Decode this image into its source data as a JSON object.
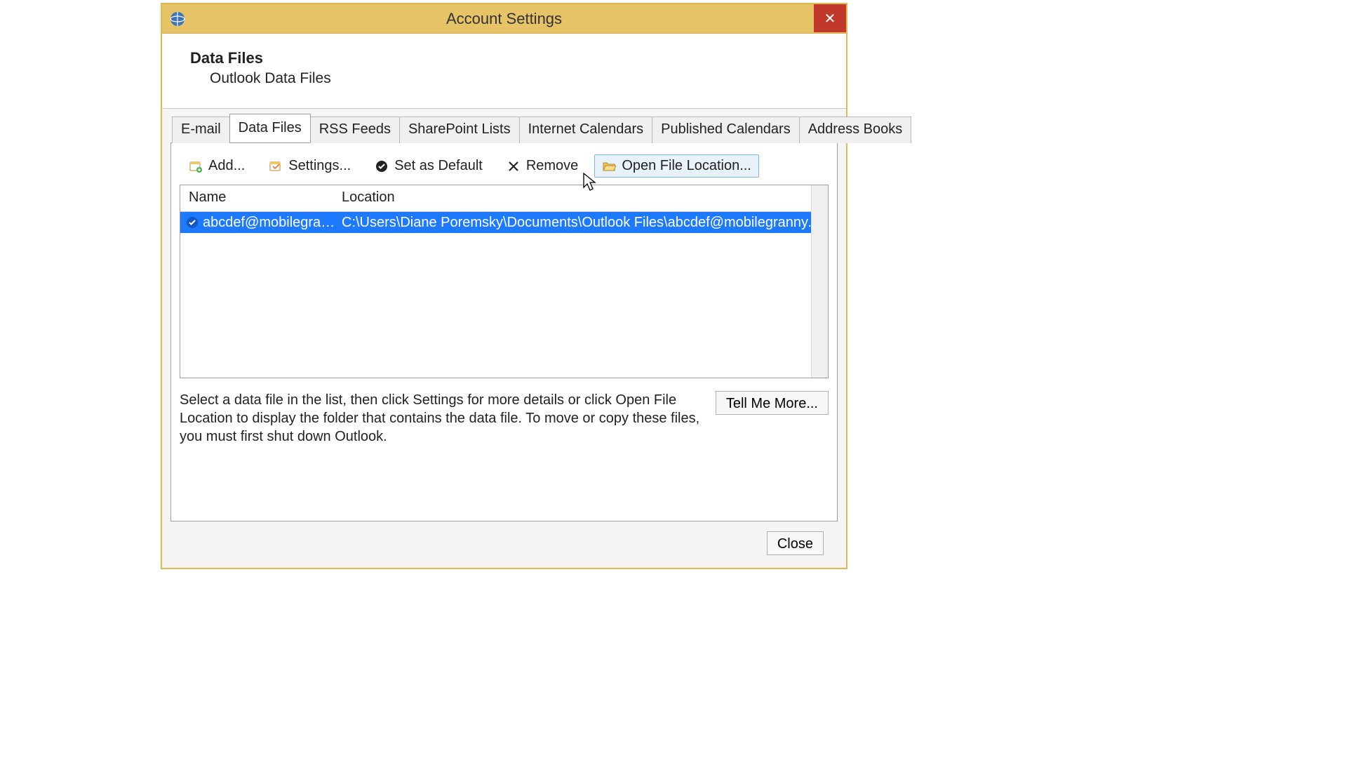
{
  "window": {
    "title": "Account Settings",
    "close_label": "✕"
  },
  "header": {
    "heading": "Data Files",
    "sub": "Outlook Data Files"
  },
  "tabs": {
    "items": [
      {
        "label": "E-mail",
        "active": false
      },
      {
        "label": "Data Files",
        "active": true
      },
      {
        "label": "RSS Feeds",
        "active": false
      },
      {
        "label": "SharePoint Lists",
        "active": false
      },
      {
        "label": "Internet Calendars",
        "active": false
      },
      {
        "label": "Published Calendars",
        "active": false
      },
      {
        "label": "Address Books",
        "active": false
      }
    ]
  },
  "toolbar": {
    "add": "Add...",
    "settings": "Settings...",
    "set_default": "Set as Default",
    "remove": "Remove",
    "open_location": "Open File Location..."
  },
  "list": {
    "columns": {
      "name": "Name",
      "location": "Location"
    },
    "rows": [
      {
        "name": "abcdef@mobilegran...",
        "location": "C:\\Users\\Diane Poremsky\\Documents\\Outlook Files\\abcdef@mobilegranny.co...",
        "selected": true,
        "default": true
      }
    ]
  },
  "info": {
    "text": "Select a data file in the list, then click Settings for more details or click Open File Location to display the folder that contains the data file. To move or copy these files, you must first shut down Outlook.",
    "tell_more": "Tell Me More..."
  },
  "footer": {
    "close": "Close"
  }
}
